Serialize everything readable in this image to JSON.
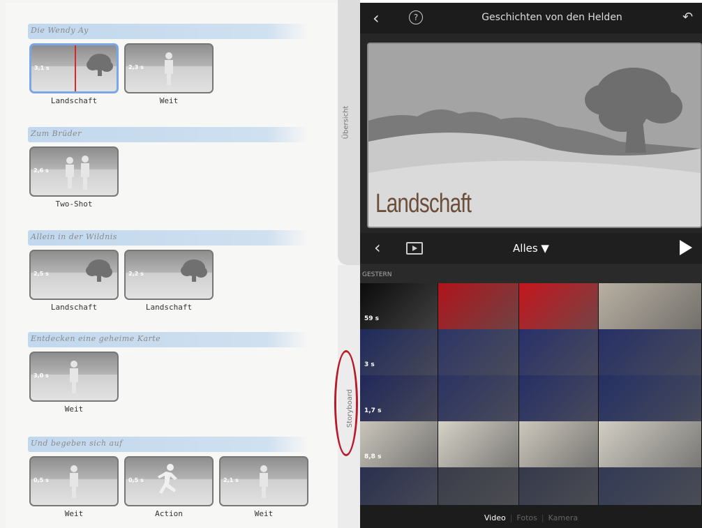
{
  "storyboard": {
    "sections": [
      {
        "title": "Die Wendy Ay",
        "clips": [
          {
            "dur": "3,1 s",
            "label": "Landschaft",
            "kind": "tree",
            "selected": true
          },
          {
            "dur": "2,3 s",
            "label": "Weit",
            "kind": "person"
          }
        ]
      },
      {
        "title": "Zum Brüder",
        "clips": [
          {
            "dur": "2,6 s",
            "label": "Two-Shot",
            "kind": "two"
          }
        ]
      },
      {
        "title": "Allein in der Wildnis",
        "clips": [
          {
            "dur": "2,5 s",
            "label": "Landschaft",
            "kind": "tree"
          },
          {
            "dur": "2,2 s",
            "label": "Landschaft",
            "kind": "tree"
          }
        ]
      },
      {
        "title": "Entdecken eine geheime Karte",
        "clips": [
          {
            "dur": "3,0 s",
            "label": "Weit",
            "kind": "person"
          }
        ]
      },
      {
        "title": "Und begeben sich auf",
        "clips": [
          {
            "dur": "0,5 s",
            "label": "Weit",
            "kind": "person"
          },
          {
            "dur": "0,5 s",
            "label": "Action",
            "kind": "run"
          },
          {
            "dur": "2,1 s",
            "label": "Weit",
            "kind": "person"
          }
        ]
      }
    ]
  },
  "side_tabs": {
    "overview": "Übersicht",
    "storyboard": "Storyboard"
  },
  "topbar": {
    "title": "Geschichten von den Helden",
    "back_icon": "chevron-left-icon",
    "help_icon": "help-icon",
    "undo_icon": "undo-icon"
  },
  "preview": {
    "title": "Landschaft"
  },
  "browser": {
    "filter": "Alles ▼",
    "date_header": "GESTERN",
    "row_labels": [
      "59 s",
      "3 s",
      "1,7 s",
      "8,8 s",
      ""
    ]
  },
  "media_tabs": {
    "video": "Video",
    "photos": "Fotos",
    "camera": "Kamera"
  },
  "colors": {
    "selected_border": "#7aa7e8",
    "playhead": "#d8262b",
    "highlight": "#b71c2a",
    "title_brown": "#6b4f3b"
  }
}
